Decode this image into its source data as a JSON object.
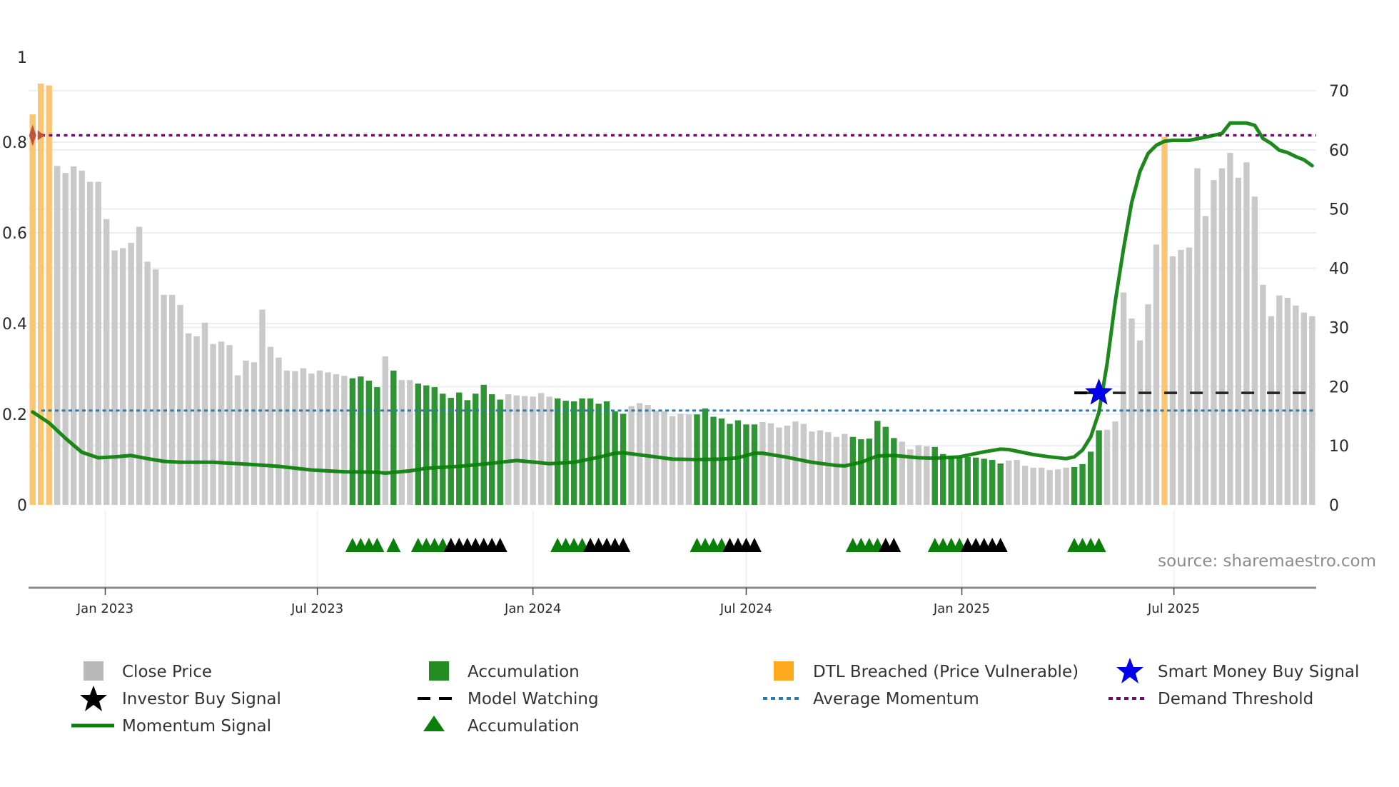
{
  "chart_data": {
    "type": "bar",
    "title": "",
    "xlabel": "",
    "ylabel_left": "",
    "ylabel_right": "",
    "left_axis": {
      "ylim": [
        0,
        1.0
      ],
      "ticks": [
        0,
        0.2,
        0.4,
        0.6,
        0.8,
        1
      ],
      "tick_labels": [
        "0",
        "0.2",
        "0.4",
        "0.6",
        "0.8",
        "1"
      ]
    },
    "right_axis": {
      "ylim": [
        0,
        70
      ],
      "ticks": [
        0,
        10,
        20,
        30,
        40,
        50,
        60,
        70
      ],
      "tick_labels": [
        "0",
        "10",
        "20",
        "30",
        "40",
        "50",
        "60",
        "70"
      ]
    },
    "x_axis": {
      "ticks": [
        "2023-01-01",
        "2023-07-01",
        "2024-01-01",
        "2024-07-01",
        "2025-01-01",
        "2025-07-01"
      ],
      "tick_labels": [
        "Jan 2023",
        "Jul 2023",
        "Jan 2024",
        "Jul 2024",
        "Jan 2025",
        "Jul 2025"
      ]
    },
    "grid": true,
    "legend_position": "bottom",
    "colors": {
      "close": "#c9c9c9",
      "accumulation": "#2f9433",
      "dtl": "#fbc673",
      "momentum": "#0a7f0a",
      "average": "#2b7bb0",
      "demand": "#6b0f6b",
      "star": "#0000ee",
      "green_marker": "#0a7f0a",
      "black_marker": "#000000",
      "dtl_marker": "#c0533a"
    },
    "dates": [
      "2022-10-31",
      "2022-11-07",
      "2022-11-14",
      "2022-11-21",
      "2022-11-28",
      "2022-12-05",
      "2022-12-12",
      "2022-12-19",
      "2022-12-26",
      "2023-01-02",
      "2023-01-09",
      "2023-01-16",
      "2023-01-23",
      "2023-01-30",
      "2023-02-06",
      "2023-02-13",
      "2023-02-20",
      "2023-02-27",
      "2023-03-06",
      "2023-03-13",
      "2023-03-20",
      "2023-03-27",
      "2023-04-03",
      "2023-04-10",
      "2023-04-17",
      "2023-04-24",
      "2023-05-01",
      "2023-05-08",
      "2023-05-15",
      "2023-05-22",
      "2023-05-29",
      "2023-06-05",
      "2023-06-12",
      "2023-06-19",
      "2023-06-26",
      "2023-07-03",
      "2023-07-10",
      "2023-07-17",
      "2023-07-24",
      "2023-07-31",
      "2023-08-07",
      "2023-08-14",
      "2023-08-21",
      "2023-08-28",
      "2023-09-04",
      "2023-09-11",
      "2023-09-18",
      "2023-09-25",
      "2023-10-02",
      "2023-10-09",
      "2023-10-16",
      "2023-10-23",
      "2023-10-30",
      "2023-11-06",
      "2023-11-13",
      "2023-11-20",
      "2023-11-27",
      "2023-12-04",
      "2023-12-11",
      "2023-12-18",
      "2023-12-25",
      "2024-01-01",
      "2024-01-08",
      "2024-01-15",
      "2024-01-22",
      "2024-01-29",
      "2024-02-05",
      "2024-02-12",
      "2024-02-19",
      "2024-02-26",
      "2024-03-04",
      "2024-03-11",
      "2024-03-18",
      "2024-03-25",
      "2024-04-01",
      "2024-04-08",
      "2024-04-15",
      "2024-04-22",
      "2024-04-29",
      "2024-05-06",
      "2024-05-13",
      "2024-05-20",
      "2024-05-27",
      "2024-06-03",
      "2024-06-10",
      "2024-06-17",
      "2024-06-24",
      "2024-07-01",
      "2024-07-08",
      "2024-07-15",
      "2024-07-22",
      "2024-07-29",
      "2024-08-05",
      "2024-08-12",
      "2024-08-19",
      "2024-08-26",
      "2024-09-02",
      "2024-09-09",
      "2024-09-16",
      "2024-09-23",
      "2024-09-30",
      "2024-10-07",
      "2024-10-14",
      "2024-10-21",
      "2024-10-28",
      "2024-11-04",
      "2024-11-11",
      "2024-11-18",
      "2024-11-25",
      "2024-12-02",
      "2024-12-09",
      "2024-12-16",
      "2024-12-23",
      "2024-12-30",
      "2025-01-06",
      "2025-01-13",
      "2025-01-20",
      "2025-01-27",
      "2025-02-03",
      "2025-02-10",
      "2025-02-17",
      "2025-02-24",
      "2025-03-03",
      "2025-03-10",
      "2025-03-17",
      "2025-03-24",
      "2025-03-31",
      "2025-04-07",
      "2025-04-14",
      "2025-04-21",
      "2025-04-28",
      "2025-05-05",
      "2025-05-12",
      "2025-05-19",
      "2025-05-26",
      "2025-06-02",
      "2025-06-09",
      "2025-06-16",
      "2025-06-23",
      "2025-06-30",
      "2025-07-07",
      "2025-07-14",
      "2025-07-21",
      "2025-07-28",
      "2025-08-04",
      "2025-08-11",
      "2025-08-18",
      "2025-08-25",
      "2025-09-01",
      "2025-09-08",
      "2025-09-15",
      "2025-09-22",
      "2025-09-29",
      "2025-10-06",
      "2025-10-13",
      "2025-10-20",
      "2025-10-27"
    ],
    "close": [
      66,
      71.2,
      70.9,
      57.3,
      56.1,
      57.2,
      56.5,
      54.6,
      54.6,
      48.3,
      43.0,
      43.4,
      44.3,
      47.0,
      41.1,
      39.8,
      35.5,
      35.5,
      33.8,
      29.0,
      28.5,
      30.8,
      27.2,
      27.6,
      27.0,
      21.9,
      24.4,
      24.1,
      33.0,
      26.7,
      24.9,
      22.7,
      22.6,
      23.1,
      22.2,
      22.7,
      22.4,
      22.1,
      21.8,
      21.4,
      21.7,
      21.0,
      19.9,
      25.1,
      22.7,
      21.1,
      21.1,
      20.5,
      20.2,
      19.9,
      18.8,
      18.1,
      19.0,
      17.7,
      18.8,
      20.3,
      18.7,
      17.8,
      18.7,
      18.5,
      18.4,
      18.3,
      18.9,
      18.3,
      18.0,
      17.6,
      17.5,
      18.0,
      18.0,
      17.1,
      17.5,
      15.8,
      15.4,
      16.7,
      17.2,
      16.9,
      15.9,
      15.8,
      15.0,
      15.4,
      15.3,
      15.3,
      16.3,
      14.9,
      14.6,
      13.7,
      14.3,
      13.6,
      13.6,
      14.0,
      13.8,
      13.1,
      13.4,
      14.1,
      13.7,
      12.4,
      12.6,
      12.3,
      11.5,
      12.0,
      11.5,
      11.1,
      11.2,
      14.2,
      13.2,
      11.3,
      10.7,
      9.4,
      10.1,
      9.9,
      9.8,
      8.6,
      8.3,
      8.1,
      8.1,
      8.0,
      7.8,
      7.6,
      7.0,
      7.5,
      7.6,
      6.6,
      6.3,
      6.3,
      5.9,
      6.0,
      6.3,
      6.4,
      6.9,
      9.0,
      12.6,
      12.7,
      14.1,
      35.9,
      31.5,
      27.8,
      33.9,
      44.0,
      62.2,
      42.0,
      43.1,
      43.5,
      56.9,
      48.8,
      54.9,
      56.9,
      59.5,
      55.3,
      57.9,
      52.1,
      37.2,
      31.9,
      35.4,
      35.0,
      33.7,
      32.5,
      31.9
    ],
    "accumulation_periods": [
      [
        "2023-07-31",
        "2023-08-21"
      ],
      [
        "2023-09-04",
        "2023-09-04"
      ],
      [
        "2023-09-25",
        "2023-12-04"
      ],
      [
        "2024-01-22",
        "2024-03-18"
      ],
      [
        "2024-05-20",
        "2024-07-08"
      ],
      [
        "2024-09-30",
        "2024-11-04"
      ],
      [
        "2024-12-09",
        "2025-02-03"
      ],
      [
        "2025-04-07",
        "2025-04-28"
      ]
    ],
    "dtl_breached_dates": [
      "2022-10-31",
      "2022-11-07",
      "2022-11-14",
      "2025-06-23"
    ],
    "momentum": [
      [
        "2022-10-31",
        0.205
      ],
      [
        "2022-11-14",
        0.181
      ],
      [
        "2022-11-28",
        0.147
      ],
      [
        "2022-12-12",
        0.116
      ],
      [
        "2022-12-26",
        0.104
      ],
      [
        "2023-01-09",
        0.106
      ],
      [
        "2023-01-23",
        0.109
      ],
      [
        "2023-02-06",
        0.102
      ],
      [
        "2023-02-20",
        0.096
      ],
      [
        "2023-03-06",
        0.094
      ],
      [
        "2023-04-03",
        0.094
      ],
      [
        "2023-05-01",
        0.09
      ],
      [
        "2023-05-29",
        0.085
      ],
      [
        "2023-06-26",
        0.077
      ],
      [
        "2023-07-24",
        0.073
      ],
      [
        "2023-08-21",
        0.072
      ],
      [
        "2023-08-28",
        0.07
      ],
      [
        "2023-09-18",
        0.075
      ],
      [
        "2023-10-02",
        0.081
      ],
      [
        "2023-10-30",
        0.085
      ],
      [
        "2023-11-27",
        0.092
      ],
      [
        "2023-12-18",
        0.098
      ],
      [
        "2024-01-15",
        0.091
      ],
      [
        "2024-02-05",
        0.094
      ],
      [
        "2024-02-26",
        0.105
      ],
      [
        "2024-03-11",
        0.114
      ],
      [
        "2024-03-18",
        0.115
      ],
      [
        "2024-04-08",
        0.108
      ],
      [
        "2024-04-29",
        0.101
      ],
      [
        "2024-05-20",
        0.1
      ],
      [
        "2024-06-10",
        0.101
      ],
      [
        "2024-06-24",
        0.104
      ],
      [
        "2024-07-08",
        0.114
      ],
      [
        "2024-07-15",
        0.114
      ],
      [
        "2024-08-05",
        0.105
      ],
      [
        "2024-08-26",
        0.094
      ],
      [
        "2024-09-16",
        0.087
      ],
      [
        "2024-09-23",
        0.086
      ],
      [
        "2024-10-07",
        0.094
      ],
      [
        "2024-10-21",
        0.108
      ],
      [
        "2024-11-04",
        0.109
      ],
      [
        "2024-11-25",
        0.104
      ],
      [
        "2024-12-09",
        0.103
      ],
      [
        "2024-12-30",
        0.106
      ],
      [
        "2025-01-20",
        0.117
      ],
      [
        "2025-02-03",
        0.123
      ],
      [
        "2025-02-10",
        0.122
      ],
      [
        "2025-03-03",
        0.111
      ],
      [
        "2025-03-17",
        0.106
      ],
      [
        "2025-03-31",
        0.102
      ],
      [
        "2025-04-07",
        0.106
      ],
      [
        "2025-04-14",
        0.121
      ],
      [
        "2025-04-21",
        0.15
      ],
      [
        "2025-04-28",
        0.204
      ],
      [
        "2025-05-05",
        0.312
      ],
      [
        "2025-05-12",
        0.45
      ],
      [
        "2025-05-19",
        0.565
      ],
      [
        "2025-05-26",
        0.667
      ],
      [
        "2025-06-02",
        0.735
      ],
      [
        "2025-06-09",
        0.775
      ],
      [
        "2025-06-16",
        0.793
      ],
      [
        "2025-06-23",
        0.802
      ],
      [
        "2025-06-30",
        0.804
      ],
      [
        "2025-07-14",
        0.804
      ],
      [
        "2025-07-28",
        0.811
      ],
      [
        "2025-08-11",
        0.819
      ],
      [
        "2025-08-18",
        0.842
      ],
      [
        "2025-09-01",
        0.842
      ],
      [
        "2025-09-08",
        0.837
      ],
      [
        "2025-09-15",
        0.808
      ],
      [
        "2025-09-22",
        0.797
      ],
      [
        "2025-09-29",
        0.782
      ],
      [
        "2025-10-06",
        0.777
      ],
      [
        "2025-10-13",
        0.768
      ],
      [
        "2025-10-20",
        0.761
      ],
      [
        "2025-10-27",
        0.748
      ]
    ],
    "average_momentum": 0.208,
    "demand_threshold": 0.815,
    "model_watching": {
      "start": "2025-04-07",
      "end": "2025-10-27",
      "level": 0.247
    },
    "smart_money_buy_signal": {
      "date": "2025-04-28",
      "value": 0.247
    },
    "dtl_marker": {
      "date": "2022-10-31",
      "value": 0.815
    },
    "green_triangle_periods": [
      [
        "2023-07-31",
        "2023-08-21"
      ],
      [
        "2023-09-04",
        "2023-09-04"
      ],
      [
        "2023-09-25",
        "2023-10-16"
      ],
      [
        "2024-01-22",
        "2024-02-12"
      ],
      [
        "2024-05-20",
        "2024-06-10"
      ],
      [
        "2024-09-30",
        "2024-10-21"
      ],
      [
        "2024-12-09",
        "2024-12-30"
      ],
      [
        "2025-04-07",
        "2025-04-28"
      ]
    ],
    "black_triangle_periods": [
      [
        "2023-10-23",
        "2023-12-04"
      ],
      [
        "2024-02-19",
        "2024-03-18"
      ],
      [
        "2024-06-17",
        "2024-07-08"
      ],
      [
        "2024-10-28",
        "2024-11-04"
      ],
      [
        "2025-01-06",
        "2025-02-03"
      ]
    ],
    "legend": [
      {
        "label": "Close Price",
        "icon": "gray-square"
      },
      {
        "label": "Accumulation",
        "icon": "green-square"
      },
      {
        "label": "DTL Breached (Price Vulnerable)",
        "icon": "orange-square"
      },
      {
        "label": "Smart Money Buy Signal",
        "icon": "blue-star"
      },
      {
        "label": "Investor Buy Signal",
        "icon": "black-star"
      },
      {
        "label": "Model Watching",
        "icon": "black-dashed-line"
      },
      {
        "label": "Average Momentum",
        "icon": "blue-dotted-line"
      },
      {
        "label": "Demand Threshold",
        "icon": "purple-dotted-line"
      },
      {
        "label": "Momentum Signal",
        "icon": "green-line"
      },
      {
        "label": "Accumulation",
        "icon": "green-triangle"
      }
    ],
    "source": "source: sharemaestro.com"
  }
}
